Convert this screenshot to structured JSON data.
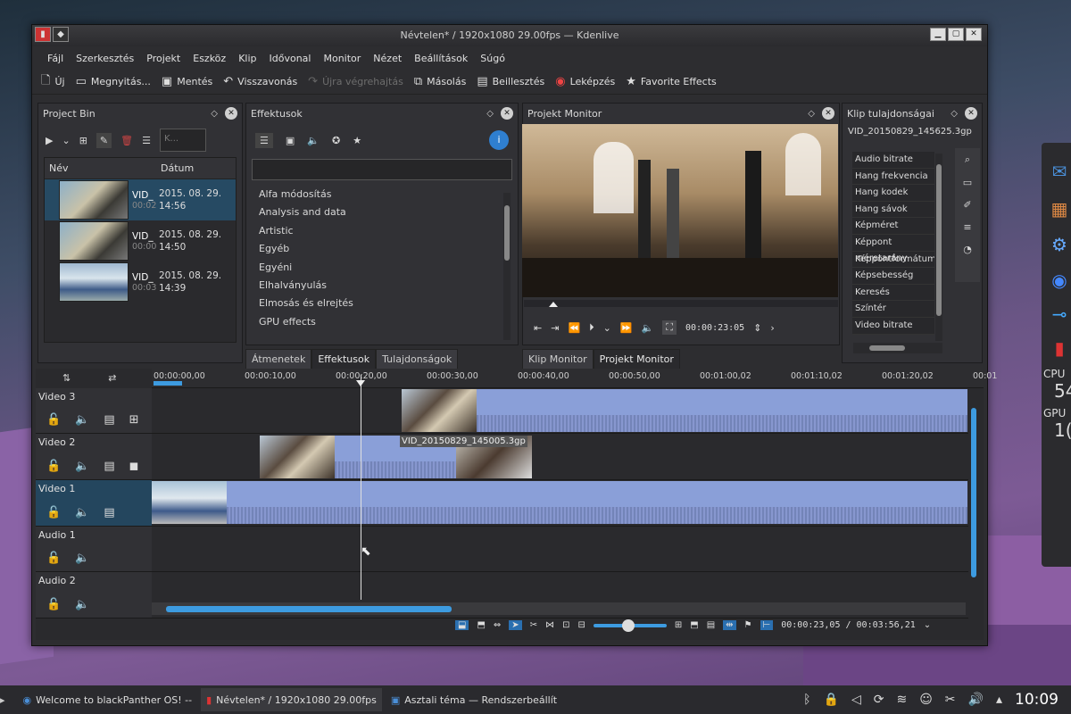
{
  "window": {
    "title": "Névtelen* / 1920x1080 29.00fps — Kdenlive",
    "app_icon": "kdenlive-icon"
  },
  "menu": [
    "Fájl",
    "Szerkesztés",
    "Projekt",
    "Eszköz",
    "Klip",
    "Idővonal",
    "Monitor",
    "Nézet",
    "Beállítások",
    "Súgó"
  ],
  "toolbar": {
    "new": "Új",
    "open": "Megnyitás...",
    "save": "Mentés",
    "undo": "Visszavonás",
    "redo": "Újra végrehajtás",
    "copy": "Másolás",
    "paste": "Beillesztés",
    "render": "Leképzés",
    "favorites": "Favorite Effects"
  },
  "project_bin": {
    "title": "Project Bin",
    "search_placeholder": "K...",
    "col_name": "Név",
    "col_date": "Dátum",
    "rows": [
      {
        "name": "VID_",
        "dur": "00:02",
        "date1": "2015. 08. 29.",
        "date2": "14:56"
      },
      {
        "name": "VID_",
        "dur": "00:00",
        "date1": "2015. 08. 29.",
        "date2": "14:50"
      },
      {
        "name": "VID_",
        "dur": "00:03",
        "date1": "2015. 08. 29.",
        "date2": "14:39"
      }
    ]
  },
  "effects": {
    "title": "Effektusok",
    "items": [
      "Alfa módosítás",
      "Analysis and data",
      "Artistic",
      "Egyéb",
      "Egyéni",
      "Elhalványulás",
      "Elmosás és elrejtés",
      "GPU effects"
    ]
  },
  "left_tabs": [
    "Átmenetek",
    "Effektusok",
    "Tulajdonságok"
  ],
  "monitor": {
    "title": "Projekt Monitor",
    "timecode": "00:00:23:05",
    "tabs": [
      "Klip Monitor",
      "Projekt Monitor"
    ]
  },
  "clip_props": {
    "title": "Klip tulajdonságai",
    "filename": "VID_20150829_145625.3gp",
    "items": [
      "Audio bitrate",
      "Hang frekvencia",
      "Hang kodek",
      "Hang sávok",
      "Képméret",
      "Képpont méretarány",
      "Képpontformátum",
      "Képsebesség",
      "Keresés",
      "Színtér",
      "Video bitrate"
    ]
  },
  "timeline": {
    "ticks": [
      "00:00:00,00",
      "00:00:10,00",
      "00:00:20,00",
      "00:00:30,00",
      "00:00:40,00",
      "00:00:50,00",
      "00:01:00,02",
      "00:01:10,02",
      "00:01:20,02",
      "00:01"
    ],
    "tracks": [
      "Video 3",
      "Video 2",
      "Video 1",
      "Audio 1",
      "Audio 2"
    ],
    "clip_label": "VID_20150829_145005.3gp",
    "position": "00:00:23,05 / 00:03:56,21"
  },
  "taskbar": {
    "items": [
      "Welcome to blackPanther OS! --",
      "Névtelen* / 1920x1080 29.00fps",
      "Asztali téma — Rendszerbeállít"
    ],
    "clock": "10:09"
  },
  "dock": {
    "cpu": "CPU",
    "cpu_val": "54",
    "gpu": "GPU",
    "gpu_val": "1("
  }
}
